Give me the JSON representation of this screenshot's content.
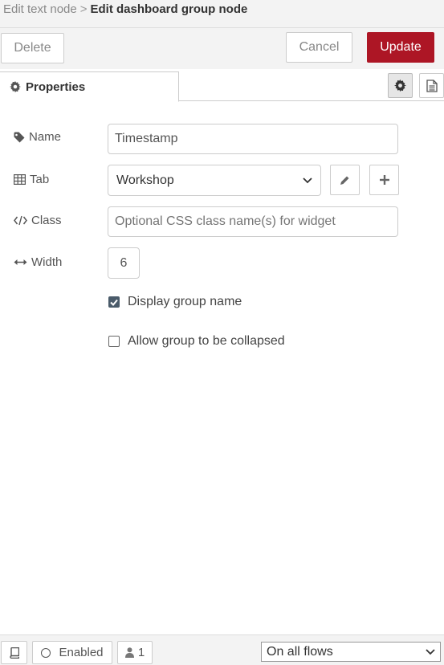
{
  "breadcrumb": {
    "parent": "Edit text node",
    "separator": ">",
    "current": "Edit dashboard group node"
  },
  "toolbar": {
    "delete_label": "Delete",
    "cancel_label": "Cancel",
    "update_label": "Update",
    "accent_color": "#ad1625"
  },
  "tabs": {
    "properties_label": "Properties"
  },
  "form": {
    "name": {
      "label": "Name",
      "value": "Timestamp"
    },
    "tab": {
      "label": "Tab",
      "selected": "Workshop"
    },
    "class": {
      "label": "Class",
      "placeholder": "Optional CSS class name(s) for widget",
      "value": ""
    },
    "width": {
      "label": "Width",
      "value": "6"
    },
    "display_group_name": {
      "label": "Display group name",
      "checked": true
    },
    "allow_collapse": {
      "label": "Allow group to be collapsed",
      "checked": false
    }
  },
  "footer": {
    "enabled_label": "Enabled",
    "users_count": "1",
    "flows_selected": "On all flows"
  },
  "icons": [
    "gear-icon",
    "document-icon",
    "tag-icon",
    "table-icon",
    "code-icon",
    "arrows-horizontal-icon",
    "pencil-icon",
    "plus-icon",
    "book-icon",
    "user-icon",
    "chevron-down-icon",
    "checkmark-icon"
  ]
}
